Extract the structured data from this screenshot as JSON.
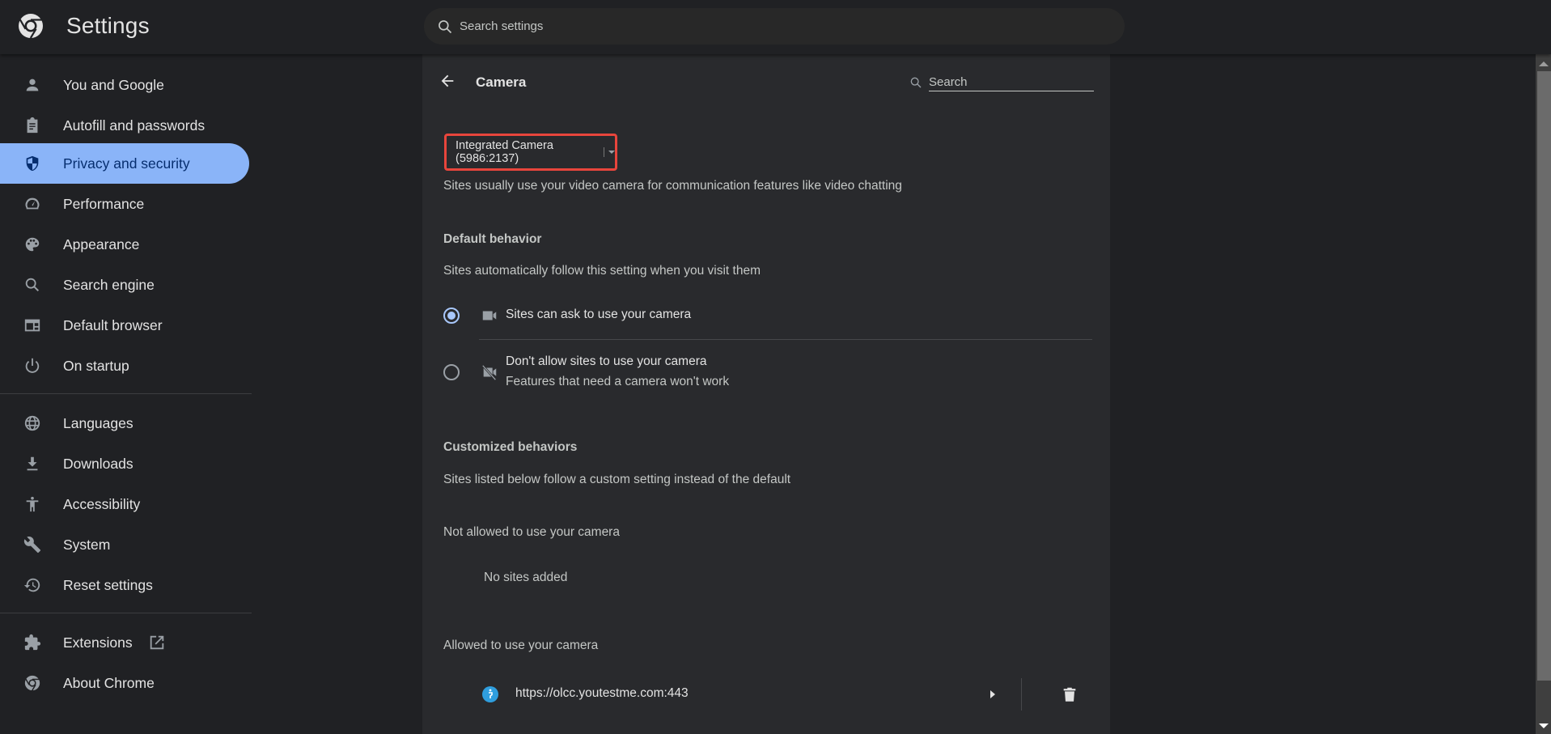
{
  "app": {
    "title": "Settings",
    "search_placeholder": "Search settings"
  },
  "sidebar": {
    "items": [
      {
        "label": "You and Google",
        "icon": "person-icon"
      },
      {
        "label": "Autofill and passwords",
        "icon": "clipboard-icon"
      },
      {
        "label": "Privacy and security",
        "icon": "shield-icon",
        "active": true
      },
      {
        "label": "Performance",
        "icon": "speedometer-icon"
      },
      {
        "label": "Appearance",
        "icon": "palette-icon"
      },
      {
        "label": "Search engine",
        "icon": "search-icon"
      },
      {
        "label": "Default browser",
        "icon": "browser-icon"
      },
      {
        "label": "On startup",
        "icon": "power-icon"
      },
      {
        "label": "Languages",
        "icon": "globe-icon"
      },
      {
        "label": "Downloads",
        "icon": "download-icon"
      },
      {
        "label": "Accessibility",
        "icon": "accessibility-icon"
      },
      {
        "label": "System",
        "icon": "wrench-icon"
      },
      {
        "label": "Reset settings",
        "icon": "history-icon"
      },
      {
        "label": "Extensions",
        "icon": "puzzle-icon"
      },
      {
        "label": "About Chrome",
        "icon": "chrome-icon"
      }
    ]
  },
  "page": {
    "title": "Camera",
    "search_placeholder": "Search",
    "device_select_value": "Integrated Camera (5986:2137)",
    "description": "Sites usually use your video camera for communication features like video chatting",
    "default_behavior": {
      "heading": "Default behavior",
      "description": "Sites automatically follow this setting when you visit them",
      "options": [
        {
          "label": "Sites can ask to use your camera",
          "sublabel": "",
          "checked": true,
          "icon": "videocam-icon"
        },
        {
          "label": "Don't allow sites to use your camera",
          "sublabel": "Features that need a camera won't work",
          "checked": false,
          "icon": "videocam-off-icon"
        }
      ]
    },
    "customized": {
      "heading": "Customized behaviors",
      "description": "Sites listed below follow a custom setting instead of the default",
      "not_allowed": {
        "heading": "Not allowed to use your camera",
        "empty_text": "No sites added"
      },
      "allowed": {
        "heading": "Allowed to use your camera",
        "sites": [
          {
            "url": "https://olcc.youtestme.com:443"
          }
        ]
      }
    }
  },
  "colors": {
    "accent": "#8ab4f8",
    "highlight_border": "#e8453c",
    "favicon": "#2f9ede"
  }
}
